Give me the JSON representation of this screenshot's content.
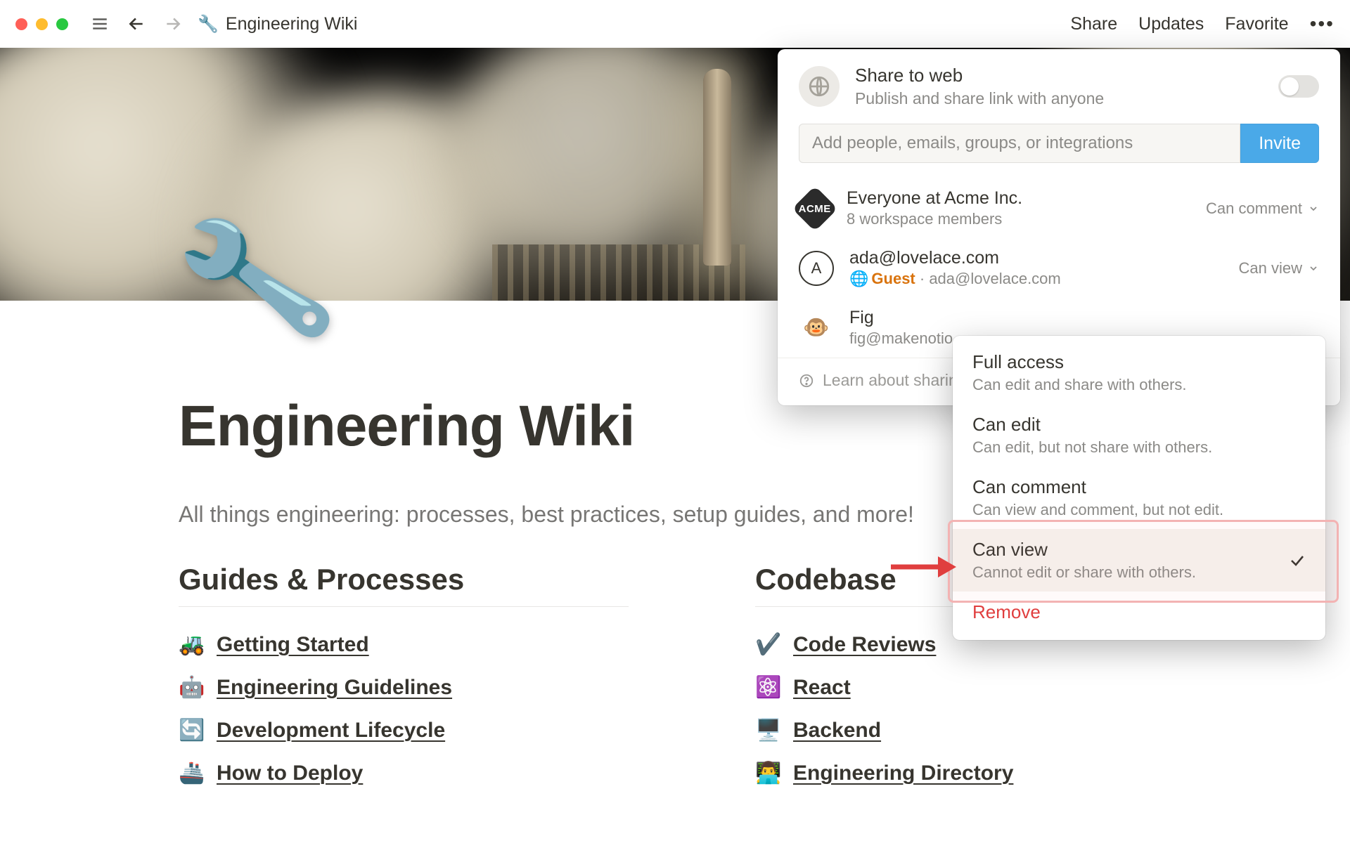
{
  "topbar": {
    "breadcrumb_icon": "🔧",
    "breadcrumb_title": "Engineering Wiki",
    "actions": {
      "share": "Share",
      "updates": "Updates",
      "favorite": "Favorite"
    }
  },
  "page": {
    "icon": "🔧",
    "title": "Engineering Wiki",
    "subtitle": "All things engineering: processes, best practices, setup guides, and more!",
    "columns": [
      {
        "heading": "Guides & Processes",
        "links": [
          {
            "emoji": "🚜",
            "label": "Getting Started"
          },
          {
            "emoji": "🤖",
            "label": "Engineering Guidelines"
          },
          {
            "emoji": "🔄",
            "label": "Development Lifecycle"
          },
          {
            "emoji": "🚢",
            "label": "How to Deploy"
          }
        ]
      },
      {
        "heading": "Codebase",
        "links": [
          {
            "emoji": "✔️",
            "label": "Code Reviews"
          },
          {
            "emoji": "⚛️",
            "label": "React"
          },
          {
            "emoji": "🖥️",
            "label": "Backend"
          },
          {
            "emoji": "👨‍💻",
            "label": "Engineering Directory"
          }
        ]
      }
    ]
  },
  "share": {
    "web_title": "Share to web",
    "web_sub": "Publish and share link with anyone",
    "invite_placeholder": "Add people, emails, groups, or integrations",
    "invite_button": "Invite",
    "members": [
      {
        "avatar_type": "acme",
        "avatar_text": "ACME",
        "name": "Everyone at Acme Inc.",
        "sub": "8 workspace members",
        "perm": "Can comment"
      },
      {
        "avatar_type": "circle",
        "avatar_text": "A",
        "name": "ada@lovelace.com",
        "guest_label": "Guest",
        "sub_tail": " · ada@lovelace.com",
        "perm": "Can view"
      },
      {
        "avatar_type": "fig",
        "avatar_text": "🐵",
        "name": "Fig",
        "sub": "fig@makenotio",
        "perm": ""
      }
    ],
    "learn": "Learn about sharin"
  },
  "perm_menu": {
    "items": [
      {
        "title": "Full access",
        "sub": "Can edit and share with others."
      },
      {
        "title": "Can edit",
        "sub": "Can edit, but not share with others."
      },
      {
        "title": "Can comment",
        "sub": "Can view and comment, but not edit."
      },
      {
        "title": "Can view",
        "sub": "Cannot edit or share with others.",
        "selected": true
      },
      {
        "title": "Remove",
        "sub": "",
        "remove": true
      }
    ]
  }
}
